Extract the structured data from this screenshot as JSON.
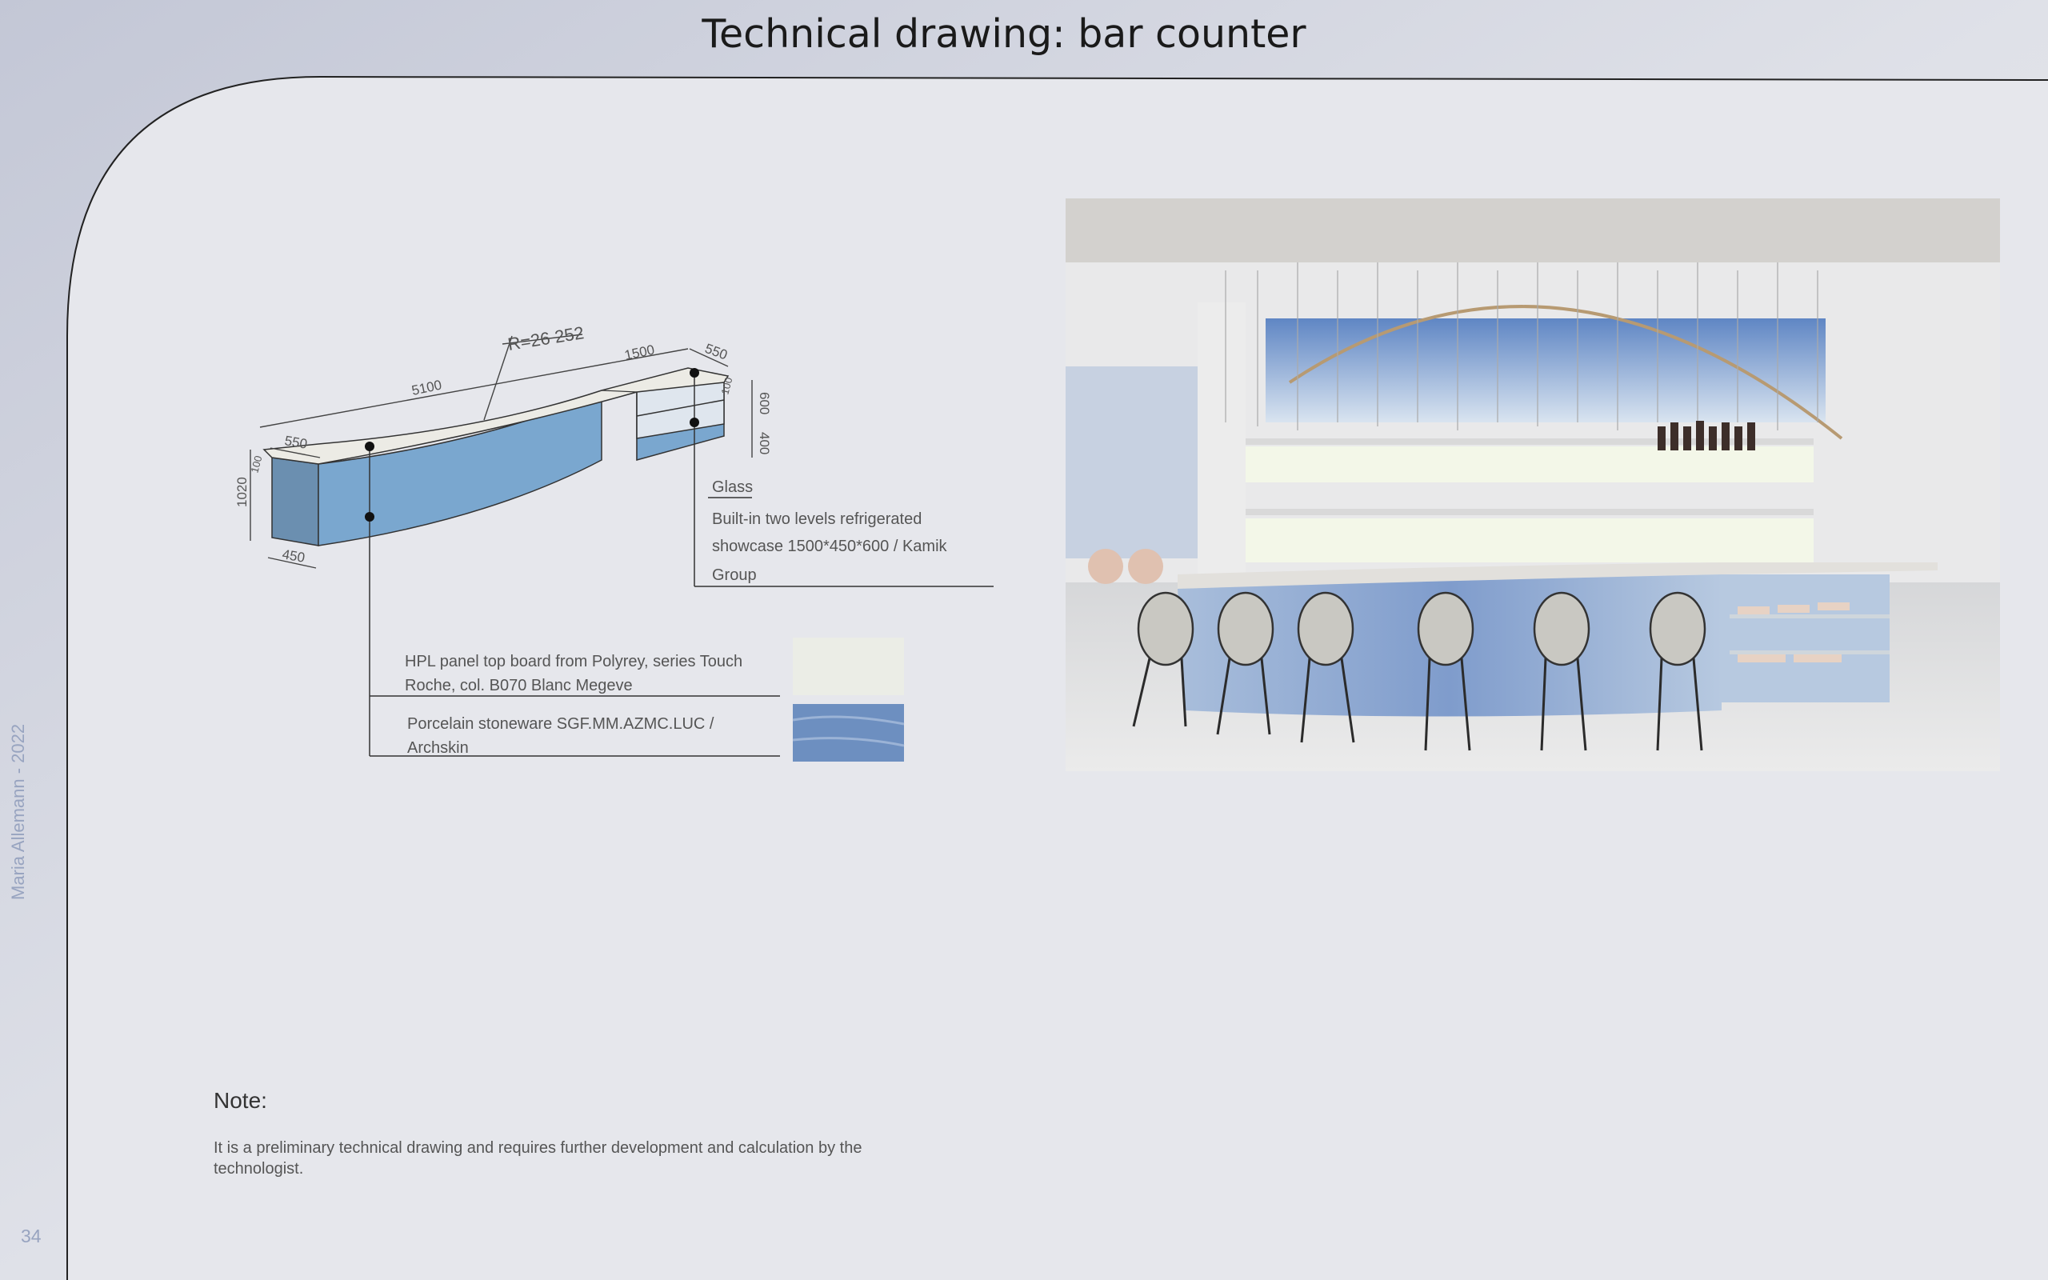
{
  "title": "Technical drawing: bar counter",
  "side_author": "Maria Allemann - 2022",
  "page_number": "34",
  "drawing": {
    "dimensions": {
      "radius": "R=26 252",
      "length_main": "5100",
      "length_showcase": "1500",
      "depth_top_left": "550",
      "depth_top_right": "550",
      "thickness_left": "100",
      "thickness_right": "100",
      "height_total": "1020",
      "showcase_height": "600",
      "showcase_lower": "400",
      "base_depth": "450"
    },
    "labels": {
      "glass": "Glass",
      "showcase_line1": "Built-in two levels refrigerated",
      "showcase_line2": "showcase 1500*450*600 / Kamik",
      "showcase_line3": "Group",
      "hpl_line1": "HPL panel top board from Polyrey, series Touch",
      "hpl_line2": "Roche, col. B070 Blanc Megeve",
      "porcelain_line1": "Porcelain stoneware SGF.MM.AZMC.LUC /",
      "porcelain_line2": "Archskin"
    },
    "colors": {
      "counter_front": "#7aa7cf",
      "counter_side": "#6b8fb0",
      "counter_top": "#ecebe5",
      "swatch_hpl": "#ebede6",
      "swatch_porcelain": "#6d8fc0"
    }
  },
  "note": {
    "title": "Note:",
    "text": "It is a preliminary technical drawing and requires further development and calculation by the technologist."
  }
}
